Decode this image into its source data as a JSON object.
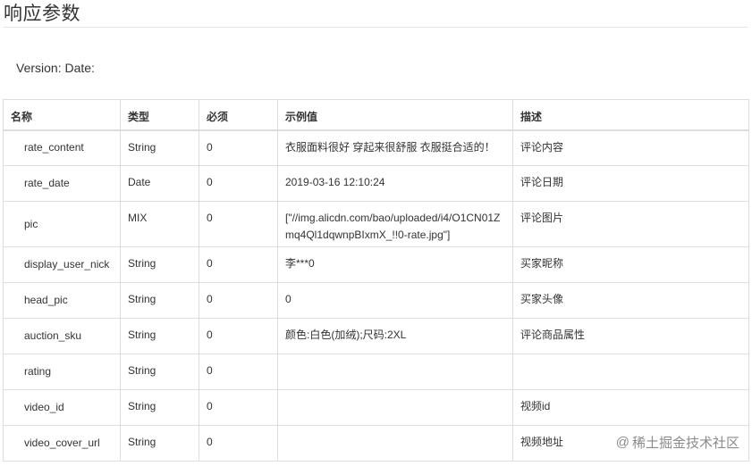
{
  "page": {
    "title": "响应参数",
    "version_line": "Version: Date:"
  },
  "table": {
    "headers": {
      "name": "名称",
      "type": "类型",
      "required": "必须",
      "example": "示例值",
      "description": "描述"
    },
    "rows": [
      {
        "name": "rate_content",
        "type": "String",
        "required": "0",
        "example": "衣服面料很好 穿起来很舒服 衣服挺合适的！",
        "description": "评论内容"
      },
      {
        "name": "rate_date",
        "type": "Date",
        "required": "0",
        "example": "2019-03-16 12:10:24",
        "description": "评论日期"
      },
      {
        "name": "pic",
        "type": "MIX",
        "required": "0",
        "example": "[\"//img.alicdn.com/bao/uploaded/i4/O1CN01Zmq4Ql1dqwnpBIxmX_!!0-rate.jpg\"]",
        "description": "评论图片"
      },
      {
        "name": "display_user_nick",
        "type": "String",
        "required": "0",
        "example": "李***0",
        "description": "买家昵称"
      },
      {
        "name": "head_pic",
        "type": "String",
        "required": "0",
        "example": "0",
        "description": "买家头像"
      },
      {
        "name": "auction_sku",
        "type": "String",
        "required": "0",
        "example": "颜色:白色(加绒);尺码:2XL",
        "description": "评论商品属性"
      },
      {
        "name": "rating",
        "type": "String",
        "required": "0",
        "example": "",
        "description": ""
      },
      {
        "name": "video_id",
        "type": "String",
        "required": "0",
        "example": "",
        "description": "视频id"
      },
      {
        "name": "video_cover_url",
        "type": "String",
        "required": "0",
        "example": "",
        "description": "视频地址"
      }
    ]
  },
  "watermark": {
    "icon": "at-icon",
    "at_symbol": "@",
    "text": "稀土掘金技术社区"
  }
}
